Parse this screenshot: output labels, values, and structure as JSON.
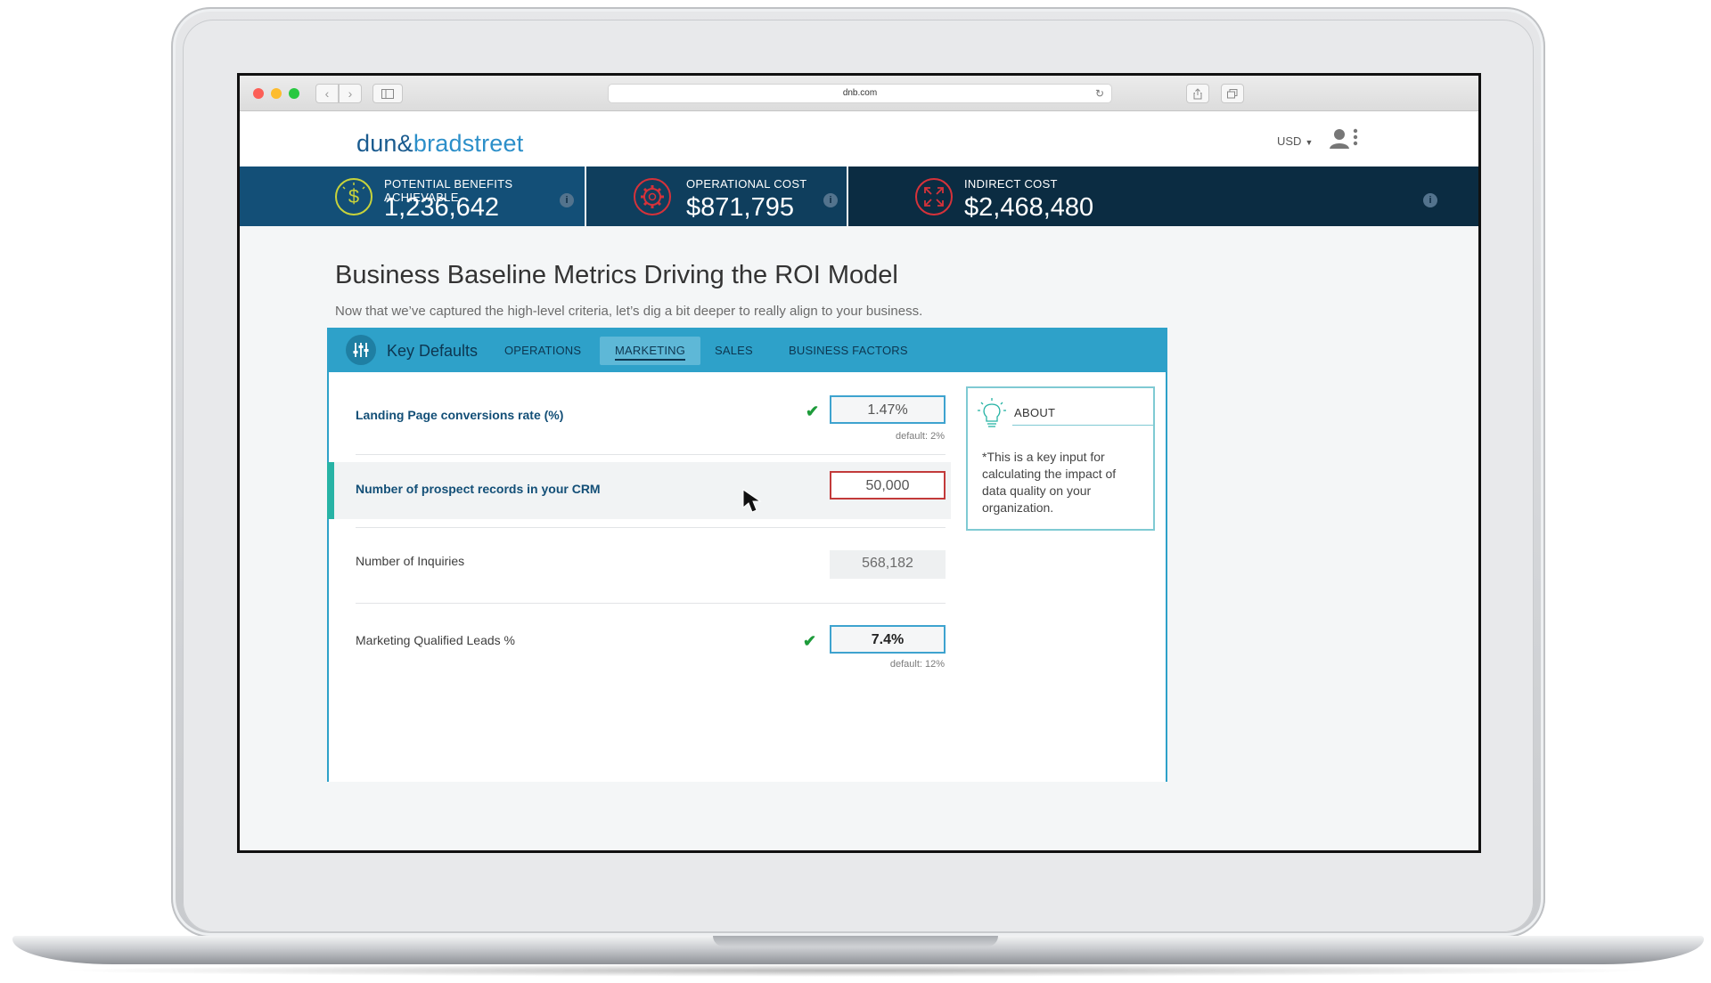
{
  "browser": {
    "url": "dnb.com"
  },
  "header": {
    "logo": {
      "part1": "dun",
      "amp": "&",
      "part2": "bradstreet"
    },
    "currency": "USD"
  },
  "kpis": [
    {
      "label": "POTENTIAL BENEFITS ACHIEVABLE",
      "value": "1,236,642",
      "icon": "dollar-icon",
      "color": "#c8d33b"
    },
    {
      "label": "OPERATIONAL COST",
      "value": "$871,795",
      "icon": "gear-icon",
      "color": "#d6323a"
    },
    {
      "label": "INDIRECT COST",
      "value": "$2,468,480",
      "icon": "expand-arrows-icon",
      "color": "#d6323a"
    }
  ],
  "main": {
    "title": "Business Baseline Metrics Driving the ROI Model",
    "subtitle": "Now that we’ve captured the high-level criteria, let’s dig a bit deeper to really align to your business."
  },
  "tabs": {
    "title": "Key Defaults",
    "items": [
      "OPERATIONS",
      "MARKETING",
      "SALES",
      "BUSINESS FACTORS"
    ],
    "active": "MARKETING"
  },
  "metrics": [
    {
      "label": "Landing Page conversions rate (%)",
      "value": "1.47%",
      "default": "default: 2%"
    },
    {
      "label": "Number of prospect records in your CRM",
      "value": "50,000"
    },
    {
      "label": "Number of Inquiries",
      "value": "568,182"
    },
    {
      "label": "Marketing Qualified Leads %",
      "value": "7.4%",
      "default": "default: 12%"
    }
  ],
  "about": {
    "title": "ABOUT",
    "text": "*This is a  key input for calculating the impact of data quality on your organization."
  }
}
